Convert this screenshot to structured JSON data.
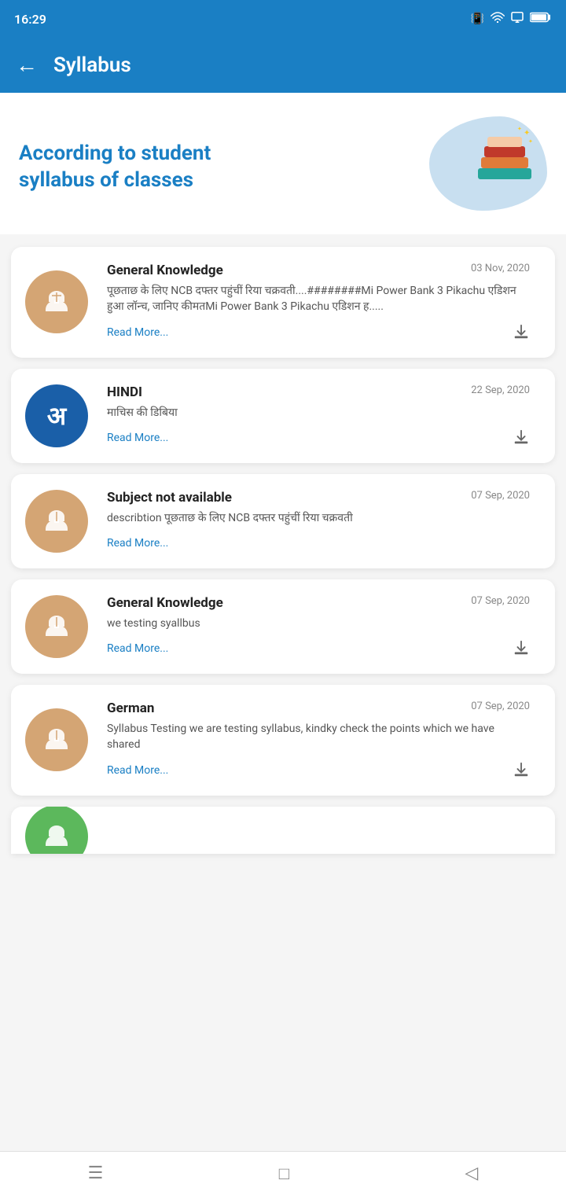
{
  "statusBar": {
    "time": "16:29",
    "icons": [
      "battery",
      "wifi",
      "signal",
      "portrait"
    ]
  },
  "header": {
    "backLabel": "←",
    "title": "Syllabus"
  },
  "hero": {
    "line1": "According to student",
    "line2": "syllabus of classes"
  },
  "cards": [
    {
      "id": 1,
      "iconType": "tan",
      "title": "General Knowledge",
      "date": "03 Nov, 2020",
      "description": "पूछताछ के लिए NCB दफ्तर पहुंचीं रिया चक्रवती....########Mi Power Bank 3 Pikachu एडिशन हुआ लॉन्च, जानिए कीमतMi Power Bank 3 Pikachu एडिशन ह.....",
      "readMoreLabel": "Read More...",
      "hasDownload": true
    },
    {
      "id": 2,
      "iconType": "blue-dark",
      "title": "HINDI",
      "date": "22 Sep, 2020",
      "description": "माचिस की डिबिया",
      "readMoreLabel": "Read More...",
      "hasDownload": true
    },
    {
      "id": 3,
      "iconType": "tan",
      "title": "Subject not available",
      "date": "07 Sep, 2020",
      "description": "describtion पूछताछ के लिए NCB दफ्तर पहुंचीं रिया चक्रवती",
      "readMoreLabel": "Read More...",
      "hasDownload": false
    },
    {
      "id": 4,
      "iconType": "tan",
      "title": "General Knowledge",
      "date": "07 Sep, 2020",
      "description": "we testing syallbus",
      "readMoreLabel": "Read More...",
      "hasDownload": true
    },
    {
      "id": 5,
      "iconType": "tan",
      "title": "German",
      "date": "07 Sep, 2020",
      "description": "Syllabus Testing we are testing syllabus, kindky check the points which we have shared",
      "readMoreLabel": "Read More...",
      "hasDownload": true
    }
  ],
  "partialCard": {
    "iconColor": "#5cb85c"
  },
  "bottomNav": {
    "menuIcon": "☰",
    "homeIcon": "□",
    "backIcon": "◁"
  }
}
